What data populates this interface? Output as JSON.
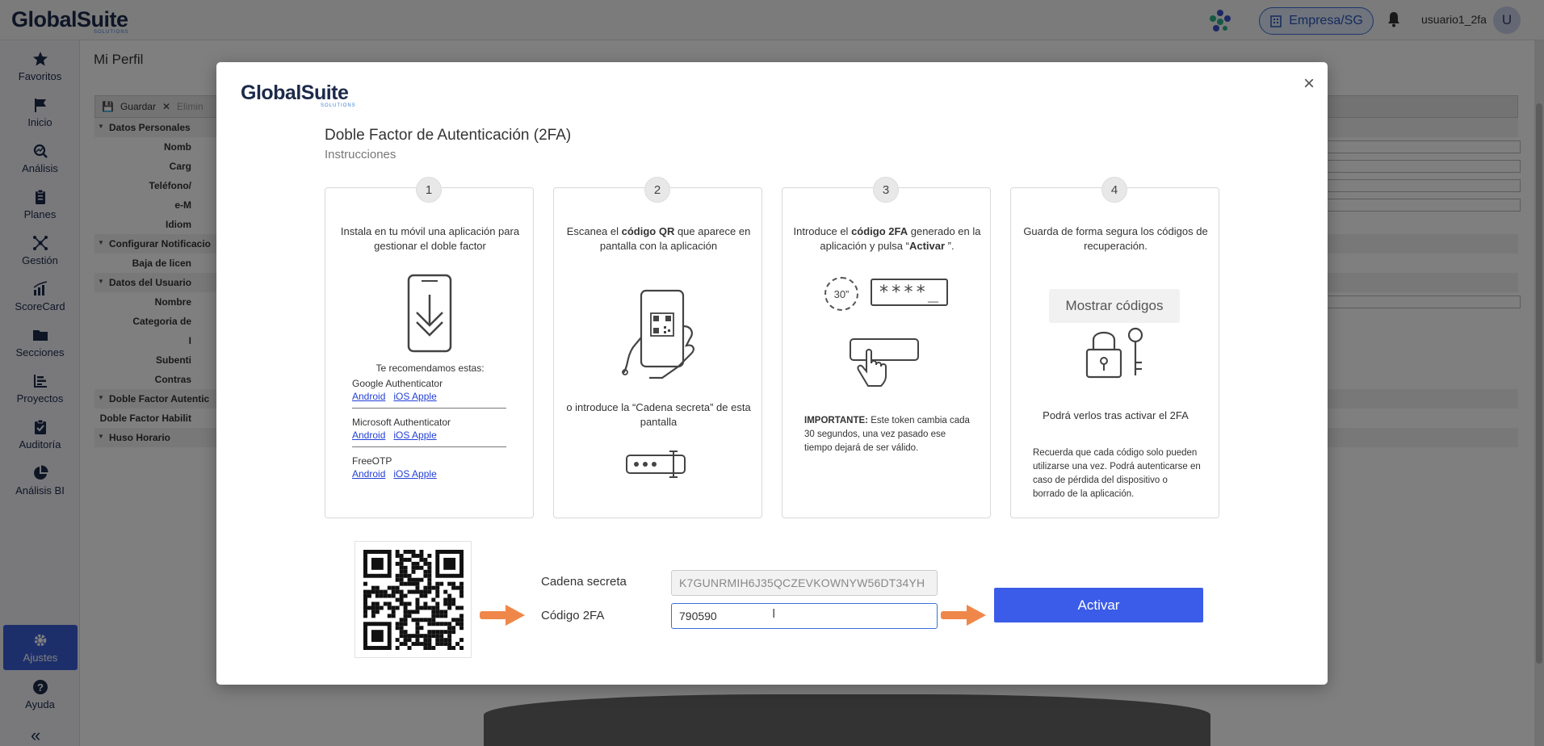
{
  "app": {
    "brand": "GlobalSuite",
    "brand_tagline": "SOLUTIONS",
    "company_label": "Empresa/SG",
    "username": "usuario1_2fa",
    "avatar_initial": "U"
  },
  "sidebar": {
    "items": [
      {
        "label": "Favoritos",
        "icon": "star-icon"
      },
      {
        "label": "Inicio",
        "icon": "flag-icon"
      },
      {
        "label": "Análisis",
        "icon": "analysis-icon"
      },
      {
        "label": "Planes",
        "icon": "clipboard-icon"
      },
      {
        "label": "Gestión",
        "icon": "network-icon"
      },
      {
        "label": "ScoreCard",
        "icon": "bar-chart-icon"
      },
      {
        "label": "Secciones",
        "icon": "folder-icon"
      },
      {
        "label": "Proyectos",
        "icon": "projects-icon"
      },
      {
        "label": "Auditoría",
        "icon": "audit-icon"
      },
      {
        "label": "Análisis BI",
        "icon": "pie-chart-icon"
      }
    ],
    "settings": "Ajustes",
    "help": "Ayuda",
    "collapse": "«"
  },
  "page": {
    "title": "Mi Perfil",
    "toolbar": {
      "save": "Guardar",
      "delete": "Elimin"
    },
    "rows": [
      {
        "label": "Datos Personales",
        "section": true
      },
      {
        "label": "Nomb",
        "section": false,
        "field": true
      },
      {
        "label": "Carg",
        "section": false,
        "field": true
      },
      {
        "label": "Teléfono/",
        "section": false,
        "field": true
      },
      {
        "label": "e-M",
        "section": false,
        "field": true
      },
      {
        "label": "Idiom",
        "section": false
      },
      {
        "label": "Configurar Notificacio",
        "section": true
      },
      {
        "label": "Baja de licen",
        "section": false
      },
      {
        "label": "Datos del Usuario",
        "section": true
      },
      {
        "label": "Nombre",
        "section": false,
        "field": true
      },
      {
        "label": "Categoria de",
        "section": false
      },
      {
        "label": "I",
        "section": false
      },
      {
        "label": "Subenti",
        "section": false
      },
      {
        "label": "Contras",
        "section": false
      },
      {
        "label": "Doble Factor Autentic",
        "section": true
      },
      {
        "label": "Doble Factor Habilit",
        "section": false
      },
      {
        "label": "Huso Horario",
        "section": true
      }
    ]
  },
  "modal": {
    "logo": "GlobalSuite",
    "logo_tagline": "SOLUTIONS",
    "close": "×",
    "title": "Doble Factor de Autenticación (2FA)",
    "subtitle": "Instrucciones",
    "step1": {
      "number": "1",
      "text": "Instala en tu móvil una aplicación para gestionar el doble factor",
      "recommend": "Te recomendamos estas:",
      "apps": [
        {
          "name": "Google Authenticator",
          "android": "Android",
          "ios": "iOS Apple"
        },
        {
          "name": "Microsoft Authenticator",
          "android": "Android",
          "ios": "iOS Apple"
        },
        {
          "name": "FreeOTP",
          "android": "Android",
          "ios": "iOS Apple"
        }
      ]
    },
    "step2": {
      "number": "2",
      "text_pre": "Escanea el ",
      "text_bold": "código QR",
      "text_post": " que aparece en pantalla con la aplicación",
      "alt_text": "o introduce la “Cadena secreta” de esta pantalla"
    },
    "step3": {
      "number": "3",
      "text_pre": "Introduce el ",
      "text_bold": "código 2FA",
      "text_mid": " generado en la aplicación y pulsa “",
      "text_bold2": "Activar",
      "text_post": " ”.",
      "timer": "30”",
      "mask": "****_",
      "important_label": "IMPORTANTE:",
      "important_text": " Este token cambia cada 30 segundos, una vez pasado ese tiempo dejará de ser válido."
    },
    "step4": {
      "number": "4",
      "text": "Guarda de forma segura los códigos de recuperación.",
      "button": "Mostrar códigos",
      "after": "Podrá verlos tras activar el 2FA",
      "note": "Recuerda que cada código solo pueden utilizarse una vez. Podrá autenticarse en caso de pérdida del dispositivo o borrado de la aplicación."
    },
    "secret_label": "Cadena secreta",
    "secret_value": "K7GUNRMIH6J35QCZEVKOWNYW56DT34YH",
    "code_label": "Código 2FA",
    "code_value": "790590",
    "activate": "Activar"
  },
  "colors": {
    "accent": "#3b5ce8",
    "brand_dark": "#1c2a4a",
    "arrow": "#f0874a",
    "link": "#2440d8"
  }
}
